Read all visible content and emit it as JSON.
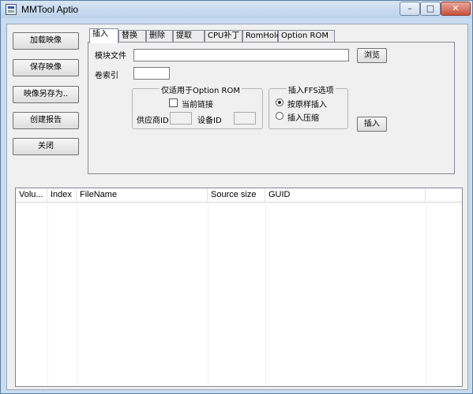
{
  "window": {
    "title": "MMTool Aptio",
    "controls": {
      "minimize": "–",
      "maximize": "□",
      "close": "✕"
    }
  },
  "sidebar": {
    "buttons": [
      "加载映像",
      "保存映像",
      "映像另存为..",
      "创建报告",
      "关闭"
    ]
  },
  "tabs": [
    "插入",
    "替换",
    "删除",
    "提取",
    "CPU补丁",
    "RomHole",
    "Option ROM"
  ],
  "active_tab": "插入",
  "insert": {
    "module_file_label": "模块文件",
    "module_file_value": "",
    "browse_button": "浏览",
    "volume_index_label": "卷索引",
    "volume_index_value": "",
    "option_rom_group": {
      "title": "仅适用于Option ROM",
      "current_link_label": "当前链接",
      "current_link_checked": false,
      "vendor_id_label": "供应商ID",
      "vendor_id_value": "",
      "device_id_label": "设备ID",
      "device_id_value": ""
    },
    "ffs_group": {
      "title": "插入FFS选项",
      "options": [
        "按原样插入",
        "插入压缩"
      ],
      "selected": "按原样插入"
    },
    "insert_button": "插入"
  },
  "list": {
    "columns": [
      "Volu...",
      "Index",
      "FileName",
      "Source size",
      "GUID"
    ],
    "rows": []
  }
}
